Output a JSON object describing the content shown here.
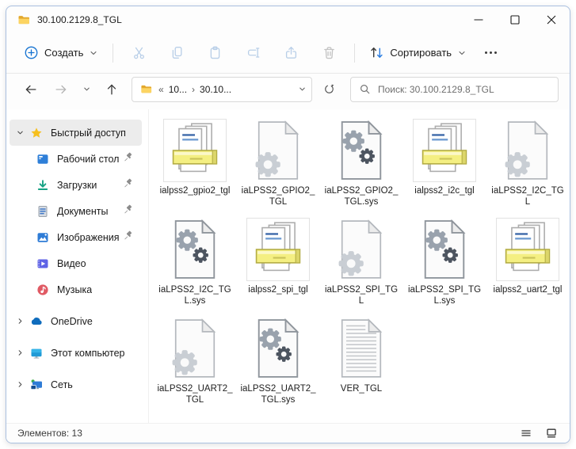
{
  "window": {
    "title": "30.100.2129.8_TGL"
  },
  "toolbar": {
    "new_label": "Создать",
    "sort_label": "Сортировать",
    "disabled_buttons": [
      {
        "icon": "cut",
        "tone": "blue"
      },
      {
        "icon": "copy",
        "tone": "blue"
      },
      {
        "icon": "paste",
        "tone": "blue"
      },
      {
        "icon": "rename",
        "tone": "blue"
      },
      {
        "icon": "share",
        "tone": "blue"
      },
      {
        "icon": "delete",
        "tone": "gray"
      }
    ]
  },
  "addressbar": {
    "overflow": "«",
    "separator": "›",
    "breadcrumbs": [
      "10...",
      "30.10..."
    ],
    "search_placeholder": "Поиск: 30.100.2129.8_TGL"
  },
  "sidebar": {
    "items": [
      {
        "label": "Быстрый доступ",
        "icon": "star",
        "level": 0,
        "chevron": "down",
        "selected": true,
        "pinned": false,
        "gap": false
      },
      {
        "label": "Рабочий стол",
        "icon": "desktop",
        "level": 1,
        "chevron": "none",
        "selected": false,
        "pinned": true,
        "gap": false
      },
      {
        "label": "Загрузки",
        "icon": "downloads",
        "level": 1,
        "chevron": "none",
        "selected": false,
        "pinned": true,
        "gap": false
      },
      {
        "label": "Документы",
        "icon": "documents",
        "level": 1,
        "chevron": "none",
        "selected": false,
        "pinned": true,
        "gap": false
      },
      {
        "label": "Изображения",
        "icon": "pictures",
        "level": 1,
        "chevron": "none",
        "selected": false,
        "pinned": true,
        "gap": false
      },
      {
        "label": "Видео",
        "icon": "video",
        "level": 1,
        "chevron": "none",
        "selected": false,
        "pinned": false,
        "gap": false
      },
      {
        "label": "Музыка",
        "icon": "music",
        "level": 1,
        "chevron": "none",
        "selected": false,
        "pinned": false,
        "gap": false
      },
      {
        "label": "OneDrive",
        "icon": "onedrive",
        "level": 0,
        "chevron": "right",
        "selected": false,
        "pinned": false,
        "gap": true
      },
      {
        "label": "Этот компьютер",
        "icon": "computer",
        "level": 0,
        "chevron": "right",
        "selected": false,
        "pinned": false,
        "gap": true
      },
      {
        "label": "Сеть",
        "icon": "network",
        "level": 0,
        "chevron": "right",
        "selected": false,
        "pinned": false,
        "gap": true
      }
    ]
  },
  "files": [
    {
      "name": "ialpss2_gpio2_tgl",
      "type": "cab"
    },
    {
      "name": "iaLPSS2_GPIO2_TGL",
      "type": "inf"
    },
    {
      "name": "iaLPSS2_GPIO2_TGL.sys",
      "type": "sys"
    },
    {
      "name": "ialpss2_i2c_tgl",
      "type": "cab"
    },
    {
      "name": "iaLPSS2_I2C_TGL",
      "type": "inf"
    },
    {
      "name": "iaLPSS2_I2C_TGL.sys",
      "type": "sys"
    },
    {
      "name": "ialpss2_spi_tgl",
      "type": "cab"
    },
    {
      "name": "iaLPSS2_SPI_TGL",
      "type": "inf"
    },
    {
      "name": "iaLPSS2_SPI_TGL.sys",
      "type": "sys"
    },
    {
      "name": "ialpss2_uart2_tgl",
      "type": "cab"
    },
    {
      "name": "iaLPSS2_UART2_TGL",
      "type": "inf"
    },
    {
      "name": "iaLPSS2_UART2_TGL.sys",
      "type": "sys"
    },
    {
      "name": "VER_TGL",
      "type": "txt"
    }
  ],
  "statusbar": {
    "items_text": "Элементов: 13"
  },
  "colors": {
    "accent": "#1673d1",
    "window_border": "#a9c0e0",
    "folder_yellow": "#fcd462",
    "disabled_icon_blue": "#b9cfe8",
    "selection_bg": "#ececec",
    "cab_band": "#f4ef82",
    "sort_arrow_blue": "#2b7de1"
  }
}
